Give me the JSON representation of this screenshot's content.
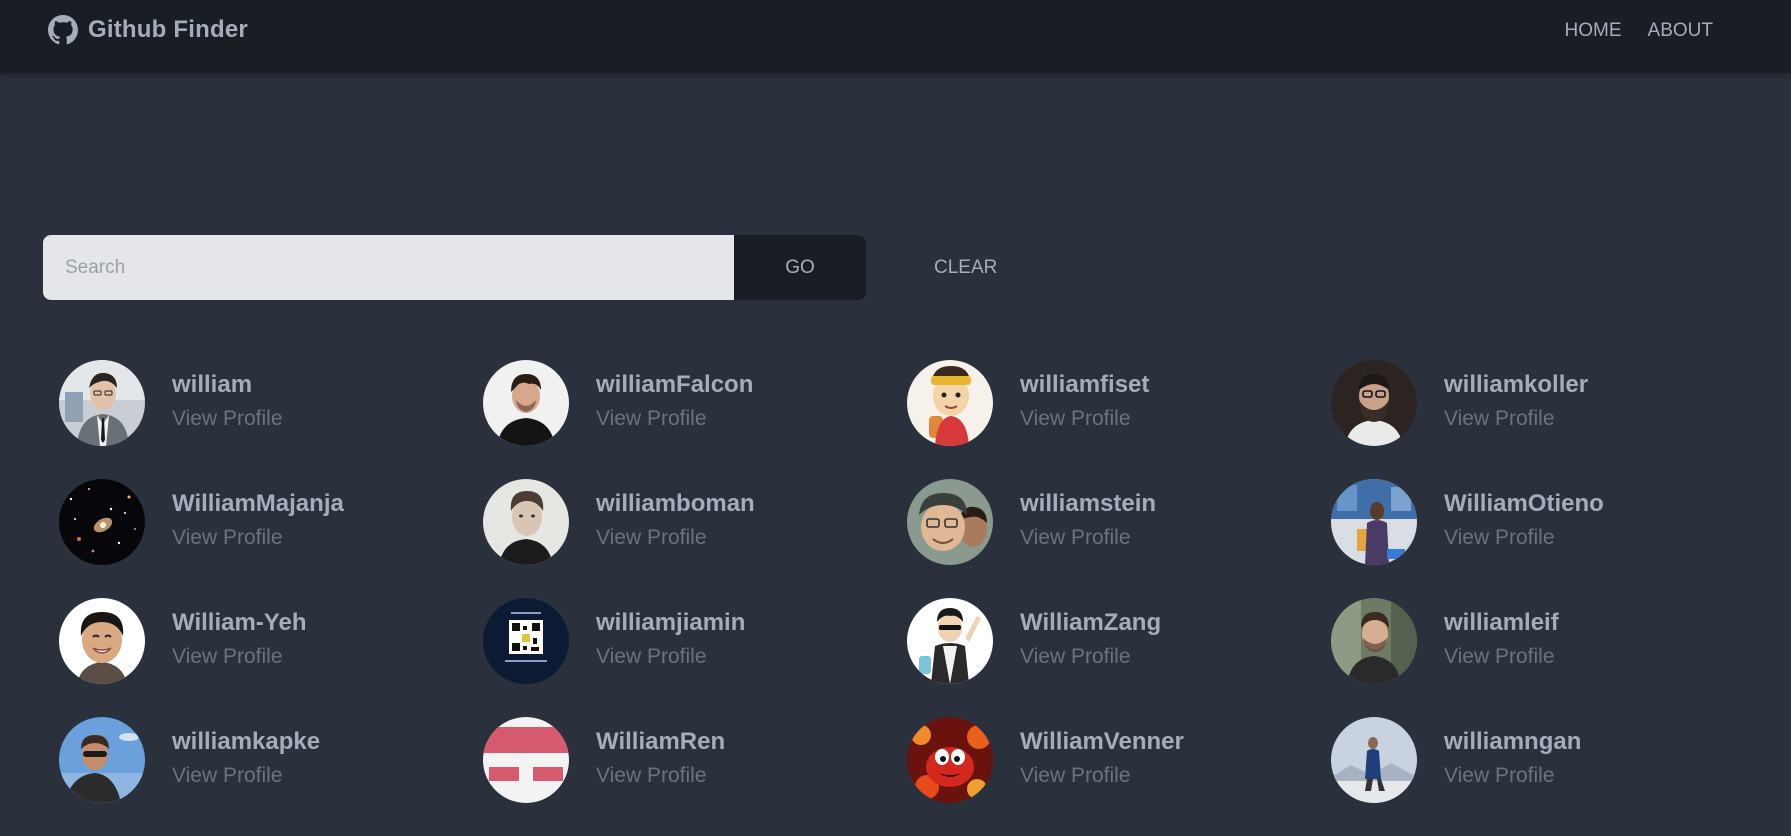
{
  "navbar": {
    "brand_title": "Github Finder",
    "brand_icon": "github-icon",
    "links": [
      "HOME",
      "ABOUT"
    ]
  },
  "search": {
    "placeholder": "Search",
    "value": "",
    "go_label": "GO",
    "clear_label": "CLEAR"
  },
  "colors": {
    "background": "#2a303c",
    "navbar": "#191d24",
    "text": "#a6adba",
    "muted": "#6b7280",
    "input_bg": "#e5e6e9"
  },
  "users": [
    {
      "login": "william",
      "link_label": "View Profile"
    },
    {
      "login": "williamFalcon",
      "link_label": "View Profile"
    },
    {
      "login": "williamfiset",
      "link_label": "View Profile"
    },
    {
      "login": "williamkoller",
      "link_label": "View Profile"
    },
    {
      "login": "WilliamMajanja",
      "link_label": "View Profile"
    },
    {
      "login": "williamboman",
      "link_label": "View Profile"
    },
    {
      "login": "williamstein",
      "link_label": "View Profile"
    },
    {
      "login": "WilliamOtieno",
      "link_label": "View Profile"
    },
    {
      "login": "William-Yeh",
      "link_label": "View Profile"
    },
    {
      "login": "williamjiamin",
      "link_label": "View Profile"
    },
    {
      "login": "WilliamZang",
      "link_label": "View Profile"
    },
    {
      "login": "williamleif",
      "link_label": "View Profile"
    },
    {
      "login": "williamkapke",
      "link_label": "View Profile"
    },
    {
      "login": "WilliamRen",
      "link_label": "View Profile"
    },
    {
      "login": "WilliamVenner",
      "link_label": "View Profile"
    },
    {
      "login": "williamngan",
      "link_label": "View Profile"
    }
  ]
}
